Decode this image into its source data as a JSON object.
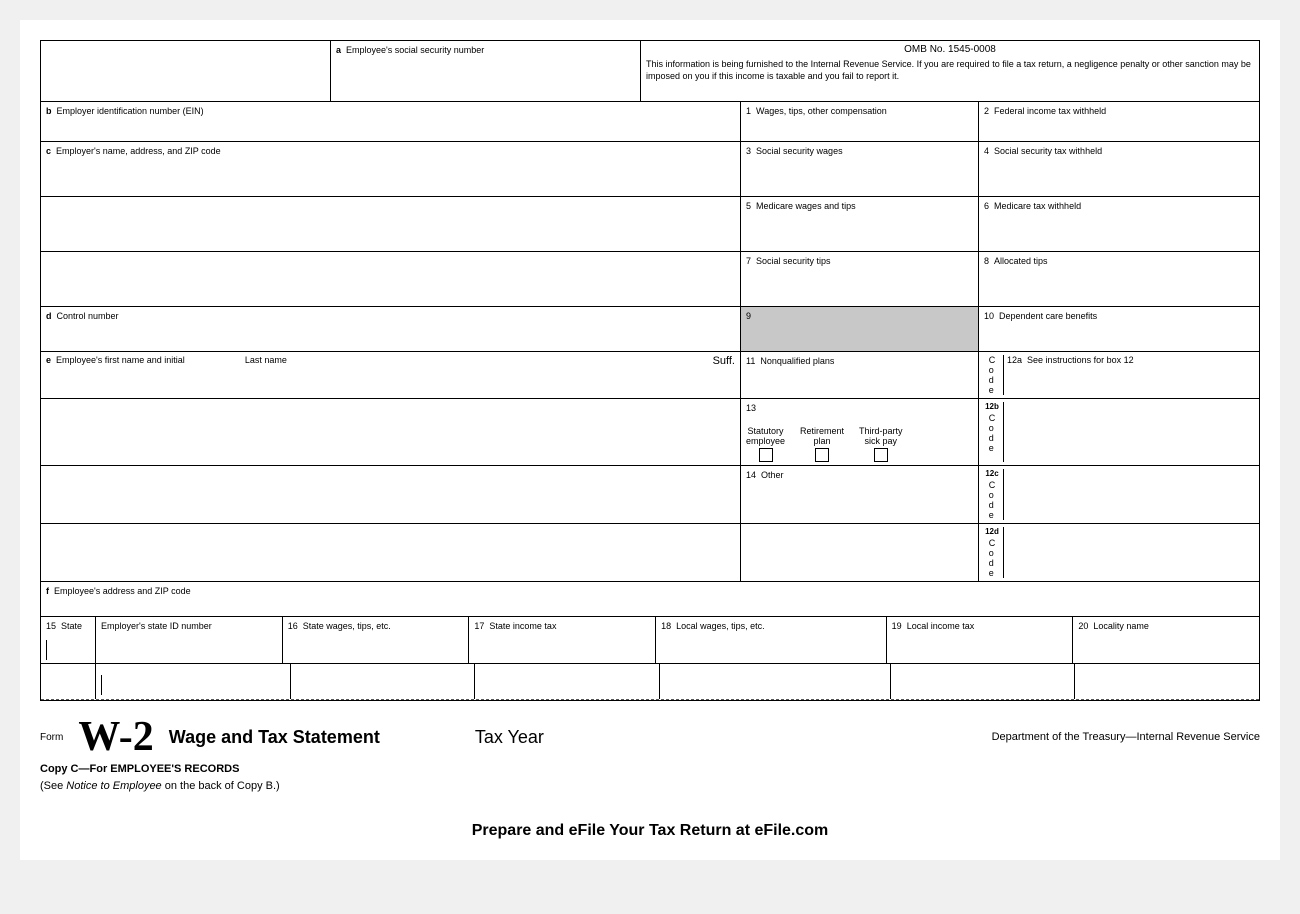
{
  "form": {
    "title": "W-2",
    "form_label": "Form",
    "full_title": "Wage and Tax Statement",
    "tax_year_label": "Tax Year",
    "dept_info": "Department of the Treasury—Internal Revenue Service",
    "copy_info_bold": "Copy C—For EMPLOYEE'S RECORDS",
    "copy_info_regular": "(See ",
    "copy_info_italic": "Notice to Employee",
    "copy_info_end": " on the back of Copy B.)",
    "prepare_banner": "Prepare and eFile Your Tax Return at eFile.com",
    "omb_number": "OMB No. 1545-0008",
    "omb_info": "This information is being furnished to the Internal Revenue Service. If you are required to file a tax return, a negligence penalty or other sanction may be imposed on you if this income is taxable and you fail to report it."
  },
  "fields": {
    "field_a_label": "a",
    "field_a_text": "Employee's social security number",
    "field_b_label": "b",
    "field_b_text": "Employer identification number (EIN)",
    "field_c_label": "c",
    "field_c_text": "Employer's name, address, and ZIP code",
    "field_d_label": "d",
    "field_d_text": "Control number",
    "field_e_label": "e",
    "field_e_text": "Employee's first name and initial",
    "field_e_lastname": "Last name",
    "field_e_suff": "Suff.",
    "field_f_label": "f",
    "field_f_text": "Employee's address and ZIP code",
    "box1_num": "1",
    "box1_text": "Wages, tips, other compensation",
    "box2_num": "2",
    "box2_text": "Federal income tax withheld",
    "box3_num": "3",
    "box3_text": "Social security wages",
    "box4_num": "4",
    "box4_text": "Social security tax withheld",
    "box5_num": "5",
    "box5_text": "Medicare wages and tips",
    "box6_num": "6",
    "box6_text": "Medicare tax withheld",
    "box7_num": "7",
    "box7_text": "Social security tips",
    "box8_num": "8",
    "box8_text": "Allocated tips",
    "box9_num": "9",
    "box10_num": "10",
    "box10_text": "Dependent care benefits",
    "box11_num": "11",
    "box11_text": "Nonqualified plans",
    "box12a_num": "12a",
    "box12a_text": "See instructions for box 12",
    "box12a_code": "C\no\nd\ne",
    "box12b_num": "12b",
    "box12b_code": "C\no\nd\ne",
    "box12c_num": "12c",
    "box12c_code": "C\no\nd\ne",
    "box12d_num": "12d",
    "box12d_code": "C\no\nd\ne",
    "box13_num": "13",
    "box13_stat_emp": "Statutory\nemployee",
    "box13_ret_plan": "Retirement\nplan",
    "box13_third": "Third-party\nsick pay",
    "box14_num": "14",
    "box14_text": "Other",
    "box15_num": "15",
    "box15_text": "State",
    "box15b_text": "Employer's state ID number",
    "box16_num": "16",
    "box16_text": "State wages, tips, etc.",
    "box17_num": "17",
    "box17_text": "State income tax",
    "box18_num": "18",
    "box18_text": "Local wages, tips, etc.",
    "box19_num": "19",
    "box19_text": "Local income tax",
    "box20_num": "20",
    "box20_text": "Locality name"
  }
}
